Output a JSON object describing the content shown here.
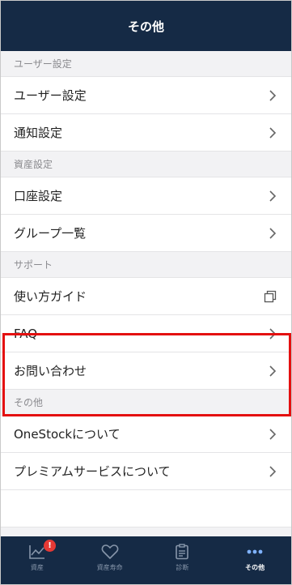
{
  "header": {
    "title": "その他"
  },
  "sections": [
    {
      "title": "ユーザー設定",
      "items": [
        {
          "label": "ユーザー設定",
          "icon": "chevron-right-icon"
        },
        {
          "label": "通知設定",
          "icon": "chevron-right-icon"
        }
      ]
    },
    {
      "title": "資産設定",
      "items": [
        {
          "label": "口座設定",
          "icon": "chevron-right-icon"
        },
        {
          "label": "グループ一覧",
          "icon": "chevron-right-icon"
        }
      ]
    },
    {
      "title": "サポート",
      "items": [
        {
          "label": "使い方ガイド",
          "icon": "copy-icon"
        },
        {
          "label": "FAQ",
          "icon": "chevron-right-icon"
        },
        {
          "label": "お問い合わせ",
          "icon": "chevron-right-icon"
        }
      ]
    },
    {
      "title": "その他",
      "items": [
        {
          "label": "OneStockについて",
          "icon": "chevron-right-icon"
        },
        {
          "label": "プレミアムサービスについて",
          "icon": "chevron-right-icon"
        }
      ]
    }
  ],
  "tabbar": {
    "tabs": [
      {
        "label": "資産",
        "icon": "line-chart-icon",
        "badge": "!"
      },
      {
        "label": "資産寿命",
        "icon": "heart-icon"
      },
      {
        "label": "診断",
        "icon": "clipboard-icon"
      },
      {
        "label": "その他",
        "icon": "more-dots-icon",
        "active": true
      }
    ]
  },
  "colors": {
    "header_bg": "#152a45",
    "highlight": "#e41010",
    "badge": "#e53935",
    "section_bg": "#f2f2f4"
  }
}
